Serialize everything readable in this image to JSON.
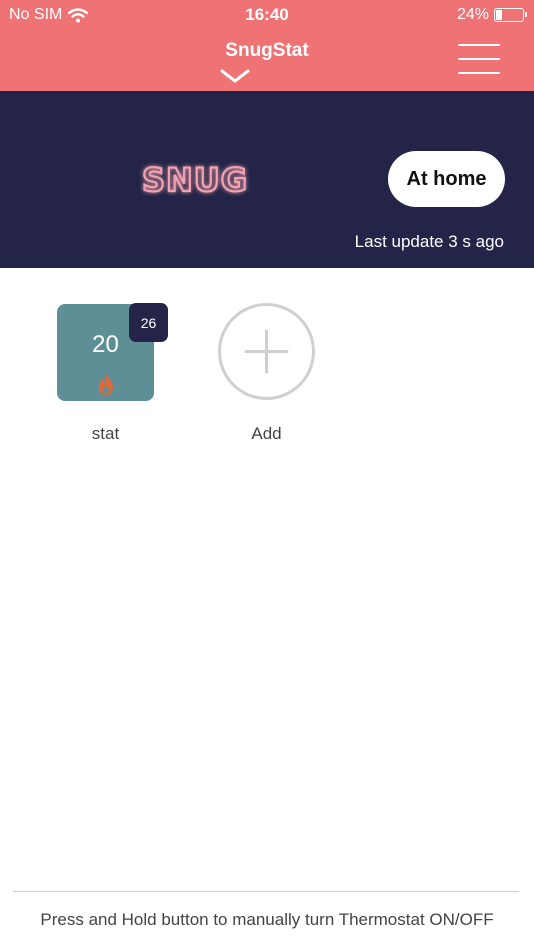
{
  "status_bar": {
    "carrier": "No SIM",
    "time": "16:40",
    "battery_text": "24%",
    "battery_level": 0.24
  },
  "nav": {
    "title": "SnugStat"
  },
  "hero": {
    "logo_text": "SNUG",
    "mode_button_label": "At home",
    "last_update": "Last update 3 s ago"
  },
  "devices": [
    {
      "name": "stat",
      "current_temp": "20",
      "setpoint": "26",
      "heating": true,
      "tile_color": "#5e8f96"
    }
  ],
  "add": {
    "label": "Add"
  },
  "footer": {
    "hint": "Press and Hold button to manually turn Thermostat ON/OFF"
  },
  "colors": {
    "accent": "#ef7275",
    "hero_bg": "#232447",
    "flame": "#e0693a"
  }
}
